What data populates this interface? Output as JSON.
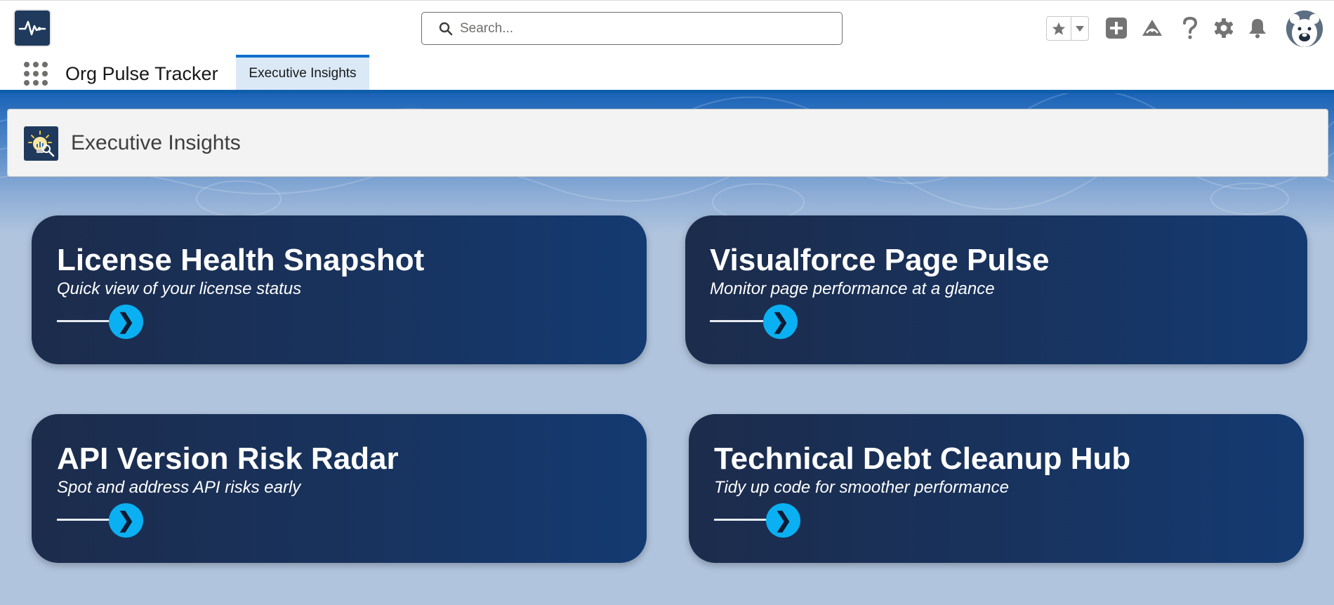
{
  "header": {
    "search": {
      "placeholder": "Search..."
    }
  },
  "app_nav": {
    "app_name": "Org Pulse Tracker",
    "tabs": [
      {
        "label": "Executive Insights",
        "active": true
      }
    ]
  },
  "page_header": {
    "title": "Executive Insights"
  },
  "cards": [
    {
      "title": "License Health Snapshot",
      "subtitle": "Quick view of your license status",
      "arrow": "❯"
    },
    {
      "title": "Visualforce Page Pulse",
      "subtitle": "Monitor page performance at a glance",
      "arrow": "❯"
    },
    {
      "title": "API Version Risk Radar",
      "subtitle": "Spot and address API risks early",
      "arrow": "❯"
    },
    {
      "title": "Technical Debt Cleanup Hub",
      "subtitle": "Tidy up code for smoother performance",
      "arrow": "❯"
    }
  ],
  "colors": {
    "brand_blue": "#0f5eac",
    "card_dark": "#1c2c4c",
    "arrow_cyan": "#0ab0f2",
    "page_bg": "#b0c4de"
  },
  "icons": [
    "app-logo-heartbeat-icon",
    "search-icon",
    "star-icon",
    "chevron-down-icon",
    "add-icon",
    "trailhead-icon",
    "help-icon",
    "setup-gear-icon",
    "bell-icon",
    "bear-avatar-icon",
    "app-launcher-icon",
    "insights-bulb-icon",
    "chevron-right-icon"
  ]
}
